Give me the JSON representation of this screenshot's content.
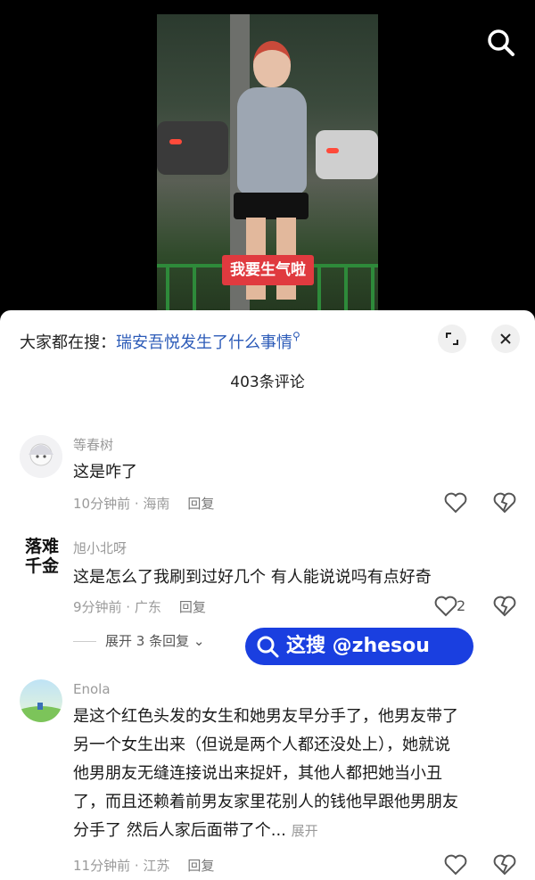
{
  "video": {
    "caption": "我要生气啦",
    "search_icon": "search-icon"
  },
  "sheet": {
    "search_prefix": "大家都在搜：",
    "search_link": "瑞安吾悦发生了什么事情",
    "comment_count": "403条评论",
    "expand_icon": "expand-icon",
    "close_icon": "close-icon"
  },
  "comments": [
    {
      "user": "等春树",
      "text": "这是咋了",
      "time_location": "10分钟前 · 海南",
      "reply": "回复",
      "likes": ""
    },
    {
      "user": "旭小北呀",
      "avatar_text_1": "落难",
      "avatar_text_2": "千金",
      "text": "这是怎么了我刷到过好几个 有人能说说吗有点好奇",
      "time_location": "9分钟前 · 广东",
      "reply": "回复",
      "likes": "2",
      "expand_replies": "展开 3 条回复"
    },
    {
      "user": "Enola",
      "text_lines": [
        "是这个红色头发的女生和她男友早分手了，他男友带了",
        "另一个女生出来（但说是两个人都还没处上），她就说",
        "他男朋友无缝连接说出来捉奸，其他人都把她当小丑",
        "了，而且还赖着前男友家里花别人的钱他早跟他男朋友",
        "分手了 然后人家后面带了个..."
      ],
      "more": "展开",
      "time_location": "11分钟前 · 江苏",
      "reply": "回复",
      "likes": ""
    }
  ],
  "watermark": {
    "text": "这搜 @zhesou"
  },
  "colors": {
    "link": "#2c5bb8",
    "caption_bg": "#e03a3f",
    "watermark_bg": "#1a3fe0"
  }
}
